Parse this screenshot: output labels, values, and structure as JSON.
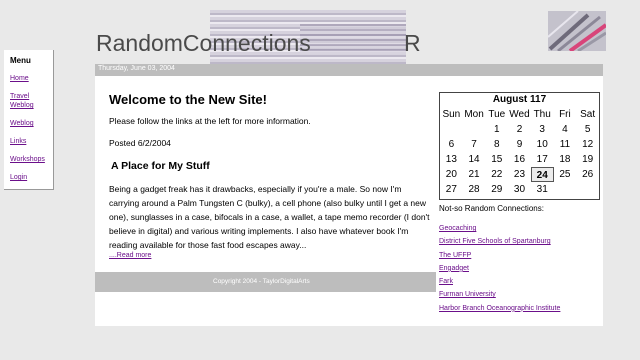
{
  "header": {
    "site_title": "RandomConnections",
    "title_tail": "R"
  },
  "date_bar": "Thursday, June 03, 2004",
  "sidebar": {
    "title": "Menu",
    "items": [
      {
        "label": "Home"
      },
      {
        "label": "Travel Weblog"
      },
      {
        "label": "Weblog"
      },
      {
        "label": "Links"
      },
      {
        "label": "Workshops"
      },
      {
        "label": "Login"
      }
    ]
  },
  "main": {
    "heading": "Welcome to the New Site!",
    "intro": "Please follow the links at the left for more information.",
    "posted": "Posted 6/2/2004",
    "post_title": "A Place for My Stuff",
    "post_body": "Being a gadget freak has it drawbacks, especially if you're a male.  So now I'm carrying around a Palm Tungsten C (bulky), a cell phone (also bulky until I get a new one), sunglasses in a case, bifocals in a case, a wallet, a tape memo recorder (I don't believe in digital) and various writing implements.  I also have whatever book I'm reading available for those fast food escapes away...",
    "read_more": "....Read more",
    "footer": "Copyright 2004 - TaylorDigitalArts"
  },
  "calendar": {
    "title": "August 117",
    "days": [
      "Sun",
      "Mon",
      "Tue",
      "Wed",
      "Thu",
      "Fri",
      "Sat"
    ],
    "cells": [
      "",
      "",
      "1",
      "2",
      "3",
      "4",
      "5",
      "6",
      "7",
      "8",
      "9",
      "10",
      "11",
      "12",
      "13",
      "14",
      "15",
      "16",
      "17",
      "18",
      "19",
      "20",
      "21",
      "22",
      "23",
      "24",
      "25",
      "26",
      "27",
      "28",
      "29",
      "30",
      "31",
      "",
      ""
    ],
    "today": "24"
  },
  "connections": {
    "title": "Not-so Random Connections:",
    "links": [
      {
        "label": "Geocaching"
      },
      {
        "label": "District Five Schools of Spartanburg"
      },
      {
        "label": "The UFFP"
      },
      {
        "label": "Engadget"
      },
      {
        "label": "Fark"
      },
      {
        "label": "Furman University"
      },
      {
        "label": "Harbor Branch Oceanographic Institute"
      }
    ]
  },
  "colors": {
    "link": "#6b0f8a",
    "bar": "#bdbdbd",
    "background": "#e9e9e9"
  }
}
